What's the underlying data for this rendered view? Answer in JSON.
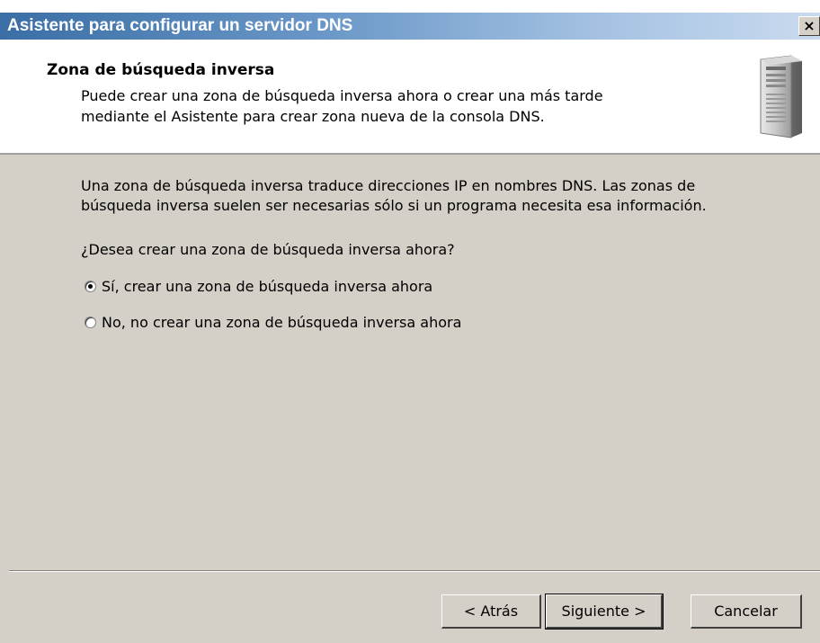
{
  "window": {
    "title": "Asistente para configurar un servidor DNS",
    "close_label": "×"
  },
  "header": {
    "title": "Zona de búsqueda inversa",
    "description_line1": "Puede crear una zona de búsqueda inversa ahora o crear una más tarde",
    "description_line2": "mediante el Asistente para crear zona nueva de la consola DNS.",
    "icon": "server-icon"
  },
  "body": {
    "paragraph_line1": "Una zona de búsqueda inversa traduce direcciones IP en nombres DNS. Las zonas de",
    "paragraph_line2": "búsqueda inversa suelen ser necesarias sólo si un programa necesita esa información.",
    "question": "¿Desea crear una zona de búsqueda inversa ahora?",
    "options": [
      {
        "label": "Sí, crear una zona de búsqueda inversa ahora",
        "selected": true
      },
      {
        "label": "No, no crear una zona de búsqueda inversa ahora",
        "selected": false
      }
    ]
  },
  "buttons": {
    "back": "< Atrás",
    "next": "Siguiente >",
    "cancel": "Cancelar"
  },
  "colors": {
    "dialog_background": "#d4d0c8",
    "titlebar_start": "#3a6ea5",
    "titlebar_end": "#c9daee",
    "header_background": "#ffffff"
  }
}
